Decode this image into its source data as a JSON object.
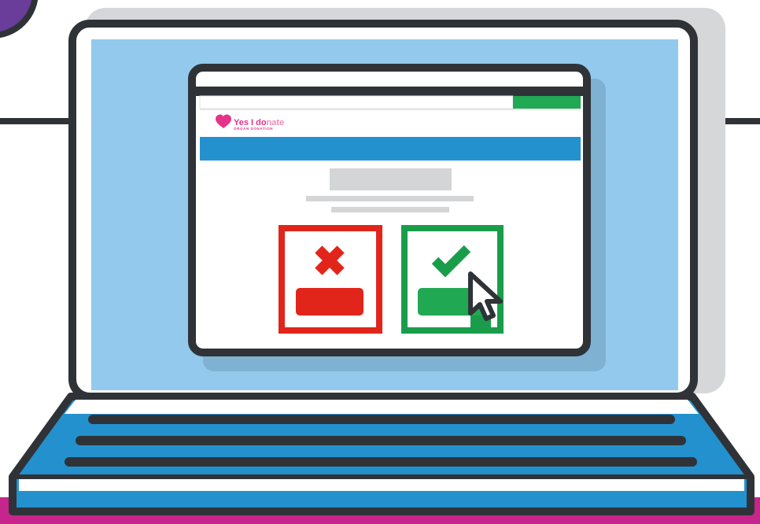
{
  "illustration": {
    "subject": "laptop-showing-organ-donation-website"
  },
  "website": {
    "logo": {
      "text_part1": "Yes I do",
      "text_part2": "nate",
      "tagline": "ORGAN DONATION",
      "icon": "heart-icon"
    },
    "choices": {
      "decline": {
        "icon": "cross-icon",
        "color": "#e1251b"
      },
      "accept": {
        "icon": "check-icon",
        "color": "#1a9d4b"
      }
    },
    "cursor": {
      "icon": "mouse-pointer-icon"
    }
  },
  "colors": {
    "outline": "#2f3338",
    "screen": "#93c9ec",
    "keyboard": "#2491cf",
    "nav_bar": "#2491cf",
    "accent_green": "#21a852",
    "placeholder_gray": "#d4d5d6",
    "background_corner_purple": "#6a3d9a",
    "bottom_strip_pink": "#c6258c",
    "logo_pink": "#e5338a"
  }
}
